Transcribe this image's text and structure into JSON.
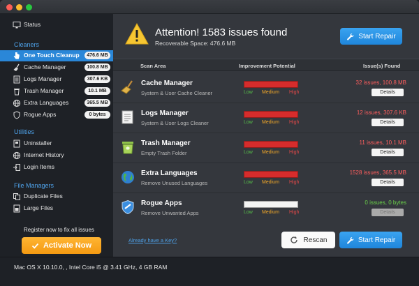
{
  "sidebar": {
    "status_label": "Status",
    "cleaners_heading": "Cleaners",
    "cleaners": [
      {
        "label": "One Touch Cleanup",
        "size": "476.6 MB",
        "icon": "pointer-hand-icon"
      },
      {
        "label": "Cache Manager",
        "size": "100.8 MB",
        "icon": "broom-icon"
      },
      {
        "label": "Logs Manager",
        "size": "307.6 KB",
        "icon": "document-icon"
      },
      {
        "label": "Trash Manager",
        "size": "10.1 MB",
        "icon": "trash-icon"
      },
      {
        "label": "Extra Languages",
        "size": "365.5 MB",
        "icon": "globe-icon"
      },
      {
        "label": "Rogue Apps",
        "size": "0 bytes",
        "icon": "shield-icon"
      }
    ],
    "utilities_heading": "Utilities",
    "utilities": [
      {
        "label": "Uninstaller"
      },
      {
        "label": "Internet History"
      },
      {
        "label": "Login Items"
      }
    ],
    "file_managers_heading": "File Managers",
    "file_managers": [
      {
        "label": "Duplicate Files"
      },
      {
        "label": "Large Files"
      }
    ],
    "register_text": "Register now to fix all issues",
    "activate_label": "Activate Now"
  },
  "header": {
    "title": "Attention! 1583 issues found",
    "subtitle": "Recoverable Space: 476.6 MB",
    "start_repair_label": "Start Repair"
  },
  "table": {
    "col_area": "Scan Area",
    "col_potential": "Improvement Potential",
    "col_found": "Issue(s) Found",
    "level_low": "Low",
    "level_medium": "Medium",
    "level_high": "High",
    "details_label": "Details",
    "rows": [
      {
        "name": "Cache Manager",
        "desc": "System & User Cache Cleaner",
        "issues": "32 issues, 100.8 MB",
        "potential": 1.0
      },
      {
        "name": "Logs Manager",
        "desc": "System & User Logs Cleaner",
        "issues": "12 issues, 307.6 KB",
        "potential": 1.0
      },
      {
        "name": "Trash Manager",
        "desc": "Empty Trash Folder",
        "issues": "11 issues, 10.1 MB",
        "potential": 1.0
      },
      {
        "name": "Extra Languages",
        "desc": "Remove Unused Languages",
        "issues": "1528 issues, 365.5 MB",
        "potential": 1.0
      },
      {
        "name": "Rogue Apps",
        "desc": "Remove Unwanted Apps",
        "issues": "0 issues, 0 bytes",
        "potential": 0.0
      }
    ]
  },
  "footer": {
    "key_link": "Already have a Key?",
    "rescan_label": "Rescan",
    "start_repair_label": "Start Repair"
  },
  "statusbar": {
    "system_info": "Mac OS X 10.10.0, , Intel Core i5 @ 3.41 GHz, 4 GB RAM"
  },
  "colors": {
    "accent_blue": "#2a87d8",
    "warning_red": "#ff5e5e",
    "ok_green": "#6bd24a",
    "activate_orange": "#f49a12"
  }
}
